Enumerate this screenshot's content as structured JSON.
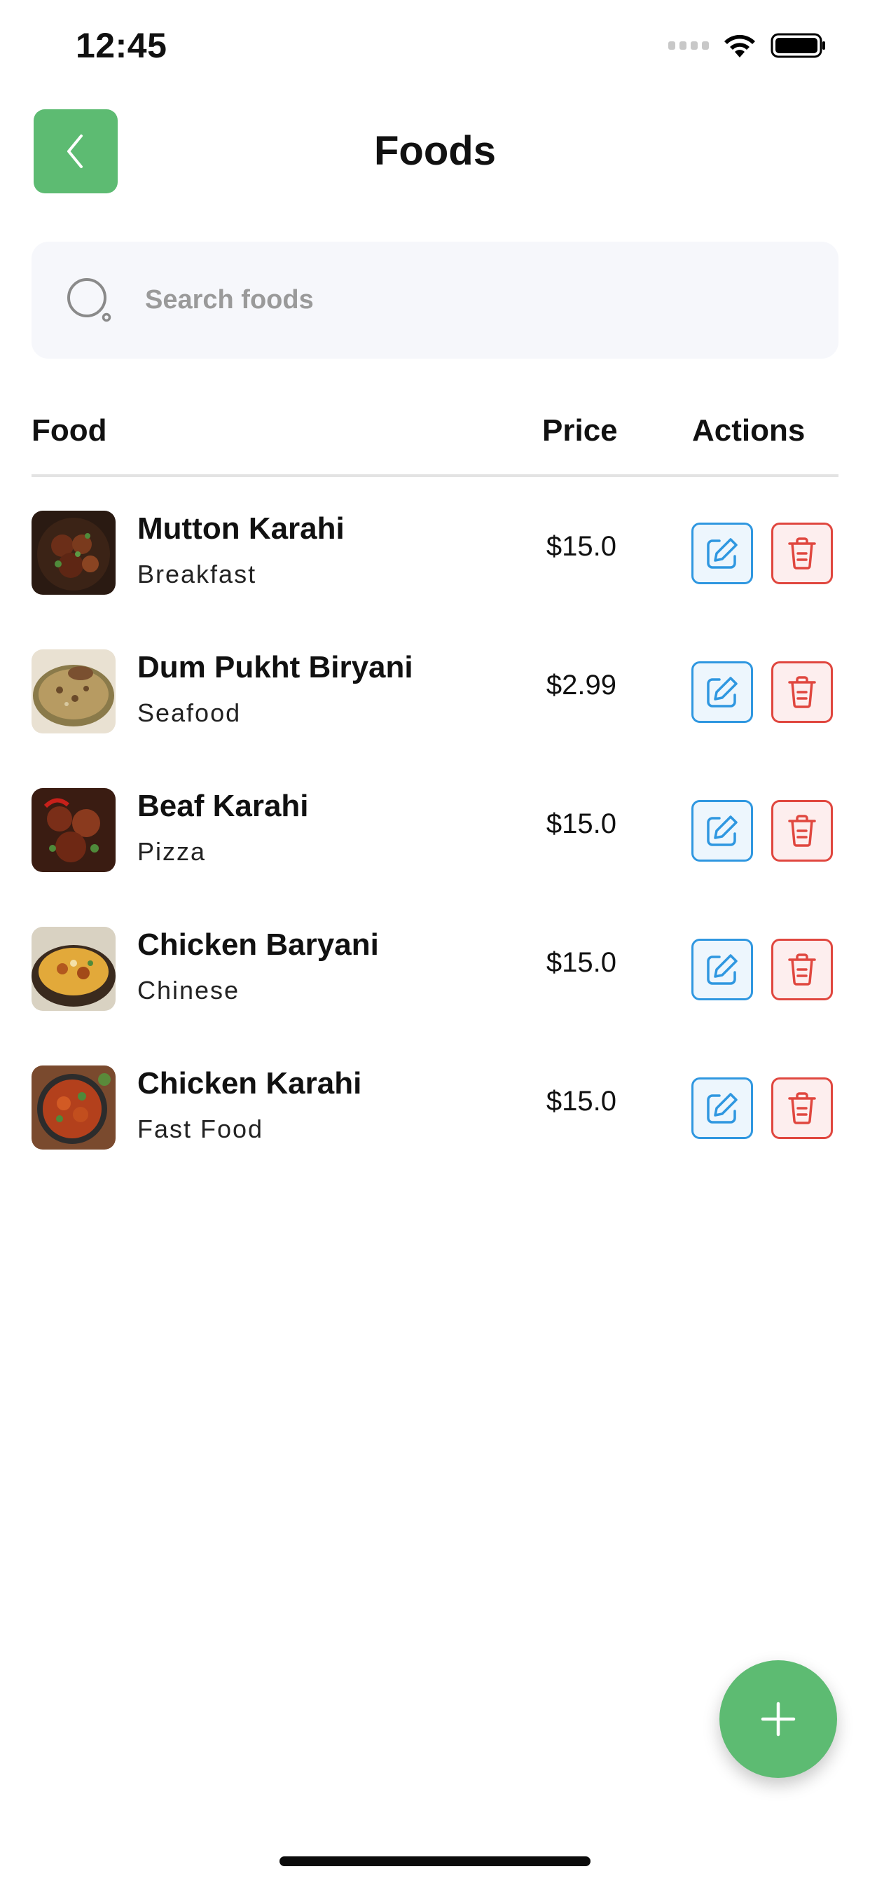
{
  "status_bar": {
    "time": "12:45"
  },
  "header": {
    "title": "Foods"
  },
  "search": {
    "placeholder": "Search foods",
    "value": ""
  },
  "table": {
    "columns": {
      "food": "Food",
      "price": "Price",
      "actions": "Actions"
    },
    "rows": [
      {
        "name": "Mutton Karahi",
        "category": "Breakfast",
        "price": "$15.0"
      },
      {
        "name": "Dum Pukht Biryani",
        "category": "Seafood",
        "price": "$2.99"
      },
      {
        "name": "Beaf Karahi",
        "category": "Pizza",
        "price": "$15.0"
      },
      {
        "name": "Chicken Baryani",
        "category": "Chinese",
        "price": "$15.0"
      },
      {
        "name": "Chicken Karahi",
        "category": "Fast Food",
        "price": "$15.0"
      }
    ]
  },
  "icons": {
    "back": "chevron-left-icon",
    "search": "search-icon",
    "edit": "edit-icon",
    "delete": "trash-icon",
    "add": "plus-icon"
  },
  "colors": {
    "accent_green": "#5dbb72",
    "edit_blue": "#2f97e0",
    "delete_red": "#e0473f",
    "search_bg": "#f6f7fb"
  }
}
